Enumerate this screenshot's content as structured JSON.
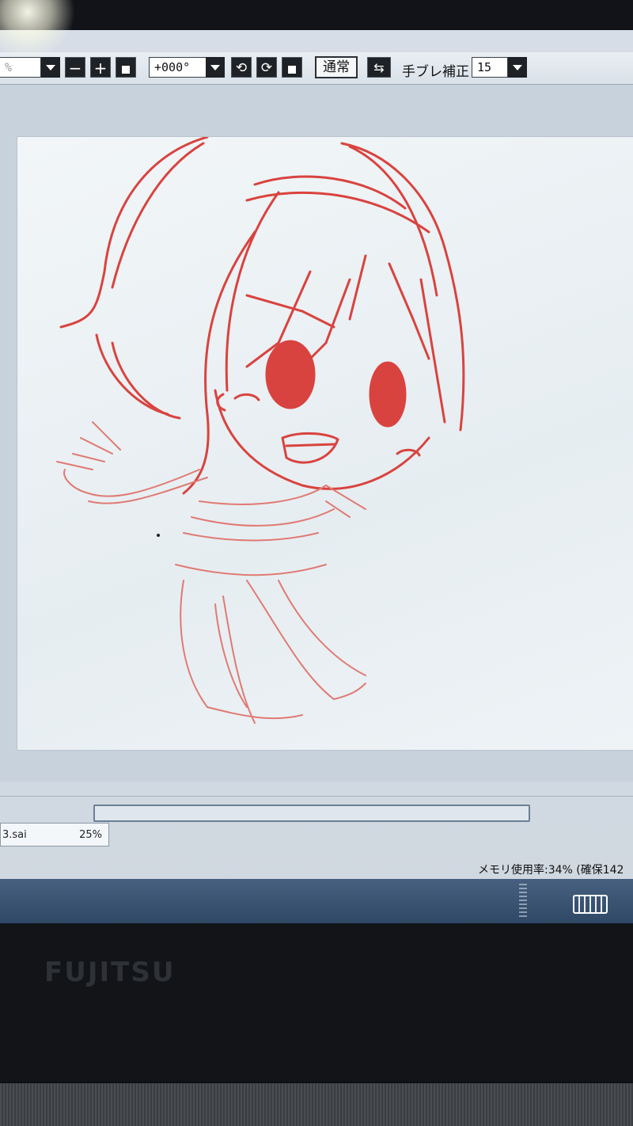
{
  "toolbar": {
    "zoom_value": "%",
    "rotation_value": "+000°",
    "blend_mode_label": "通常",
    "stabilizer_label": "手ブレ補正",
    "stabilizer_value": "15"
  },
  "file_tab": {
    "name": "3.sai",
    "zoom": "25%"
  },
  "status": {
    "memory": "メモリ使用率:34% (確保142"
  },
  "device": {
    "brand": "FUJITSU"
  },
  "icons": [
    "zoom-out-icon",
    "zoom-in-icon",
    "zoom-reset-icon",
    "rotate-left-icon",
    "rotate-right-icon",
    "rotate-reset-icon",
    "flip-horizontal-icon",
    "keyboard-icon"
  ],
  "colors": {
    "sketch_line": "#d9433f",
    "canvas": "#eef3f6",
    "taskbar": "#3b5576"
  }
}
